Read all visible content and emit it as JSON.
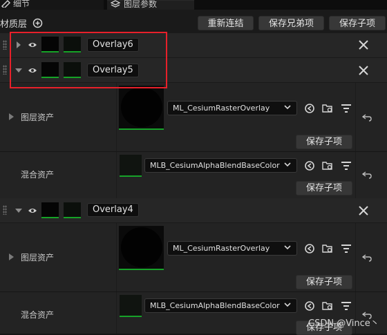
{
  "tabs": [
    {
      "label": "细节"
    },
    {
      "label": "图层参数"
    }
  ],
  "header": {
    "section_label": "材质层",
    "buttons": {
      "reconnect": "重新连结",
      "save_siblings": "保存兄弟项",
      "save_children": "保存子项"
    }
  },
  "layers": [
    {
      "name": "Overlay6",
      "expanded": false
    },
    {
      "name": "Overlay5",
      "expanded": true
    },
    {
      "name": "Overlay4",
      "expanded": true
    }
  ],
  "overlay5": {
    "layer_asset": {
      "label": "图层资产",
      "value": "ML_CesiumRasterOverlay",
      "save_label": "保存子项"
    },
    "blend_asset": {
      "label": "混合资产",
      "value": "MLB_CesiumAlphaBlendBaseColor",
      "save_label": "保存子项"
    }
  },
  "overlay4": {
    "layer_asset": {
      "label": "图层资产",
      "value": "ML_CesiumRasterOverlay",
      "save_label": "保存子项"
    },
    "blend_asset": {
      "label": "混合资产",
      "value": "MLB_CesiumAlphaBlendBaseColor",
      "save_label": "保存子项"
    }
  },
  "watermark": "CSDN @Vince丶",
  "colors": {
    "accent_green": "#16a329",
    "highlight_red": "#e8202a"
  },
  "icons": [
    "details-icon",
    "layers-icon",
    "add-circle-icon",
    "expand-arrow-icon",
    "visibility-eye-icon",
    "close-icon",
    "chevron-down-icon",
    "browse-back-icon",
    "browse-folder-icon",
    "filter-icon",
    "reset-icon"
  ]
}
